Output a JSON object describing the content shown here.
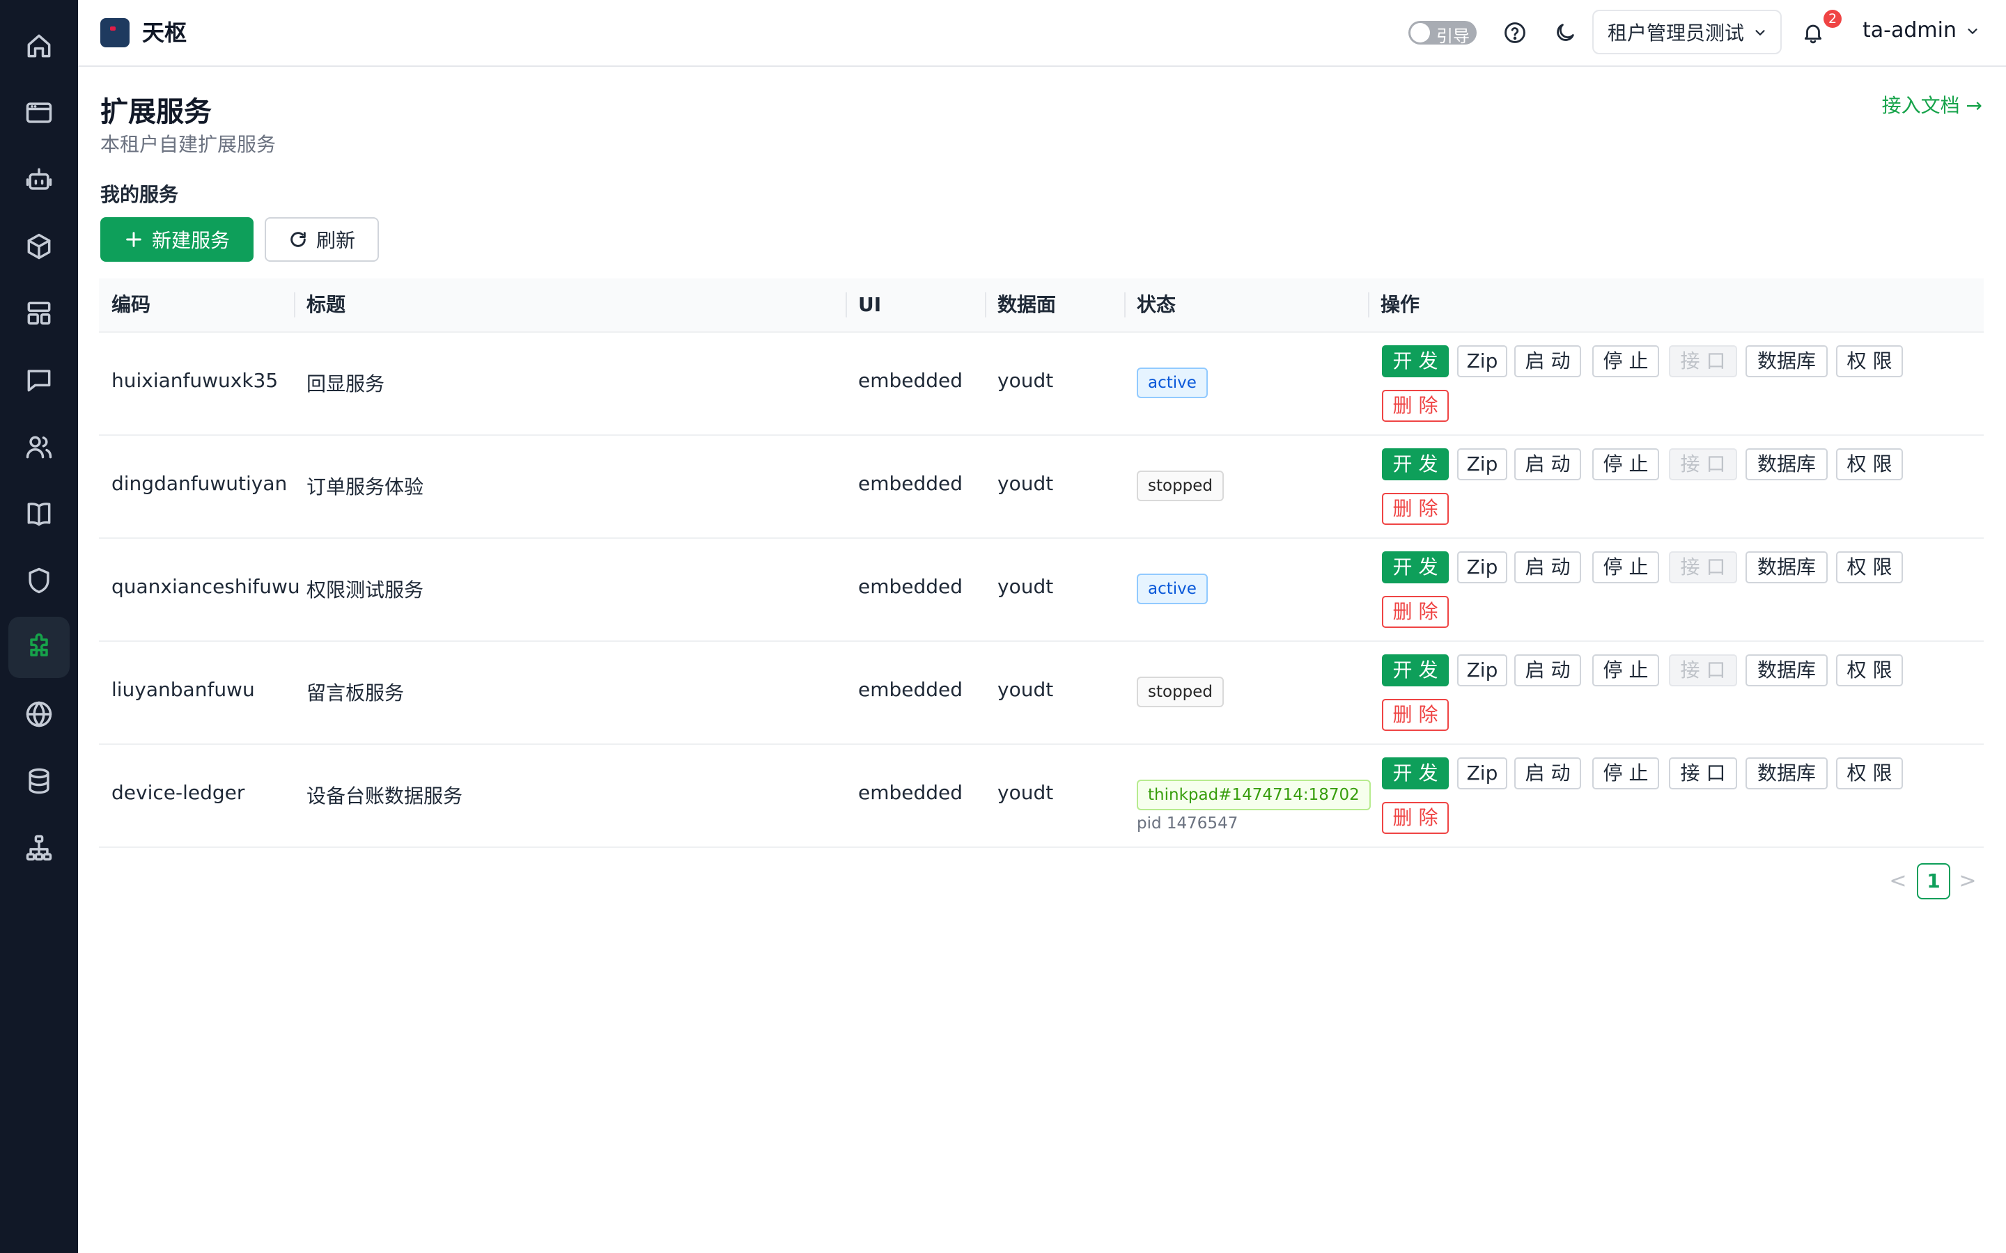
{
  "app": {
    "brand": "天枢"
  },
  "sidebar": {
    "items": [
      {
        "icon": "home-icon",
        "active": false
      },
      {
        "icon": "browser-window-icon",
        "active": false
      },
      {
        "icon": "robot-icon",
        "active": false
      },
      {
        "icon": "box-icon",
        "active": false
      },
      {
        "icon": "layout-icon",
        "active": false
      },
      {
        "icon": "chat-icon",
        "active": false
      },
      {
        "icon": "users-icon",
        "active": false
      },
      {
        "icon": "book-icon",
        "active": false
      },
      {
        "icon": "shield-icon",
        "active": false
      },
      {
        "icon": "puzzle-icon",
        "active": true
      },
      {
        "icon": "globe-icon",
        "active": false
      },
      {
        "icon": "database-icon",
        "active": false
      },
      {
        "icon": "sitemap-icon",
        "active": false
      }
    ]
  },
  "header": {
    "guide_toggle": "引导",
    "tenant": "租户管理员测试",
    "notification_count": "2",
    "user": "ta-admin"
  },
  "page": {
    "title": "扩展服务",
    "subtitle": "本租户自建扩展服务",
    "doc_link": "接入文档 →",
    "section": "我的服务"
  },
  "toolbar": {
    "new_label": "新建服务",
    "refresh_label": "刷新"
  },
  "table": {
    "columns": [
      "编码",
      "标题",
      "UI",
      "数据面",
      "状态",
      "操作"
    ],
    "actions": {
      "dev": "开 发",
      "zip": "Zip",
      "start": "启 动",
      "stop": "停 止",
      "api": "接 口",
      "db": "数据库",
      "perm": "权 限",
      "delete": "删 除"
    },
    "rows": [
      {
        "code": "huixianfuwuxk35",
        "title": "回显服务",
        "ui": "embedded",
        "plane": "youdt",
        "status": "active",
        "status_style": "active",
        "pid": "",
        "api_enabled": false
      },
      {
        "code": "dingdanfuwutiyan",
        "title": "订单服务体验",
        "ui": "embedded",
        "plane": "youdt",
        "status": "stopped",
        "status_style": "stopped",
        "pid": "",
        "api_enabled": false
      },
      {
        "code": "quanxianceshifuwu",
        "title": "权限测试服务",
        "ui": "embedded",
        "plane": "youdt",
        "status": "active",
        "status_style": "active",
        "pid": "",
        "api_enabled": false
      },
      {
        "code": "liuyanbanfuwu",
        "title": "留言板服务",
        "ui": "embedded",
        "plane": "youdt",
        "status": "stopped",
        "status_style": "stopped",
        "pid": "",
        "api_enabled": false
      },
      {
        "code": "device-ledger",
        "title": "设备台账数据服务",
        "ui": "embedded",
        "plane": "youdt",
        "status": "thinkpad#1474714:18702",
        "status_style": "green",
        "pid": "pid 1476547",
        "api_enabled": true
      }
    ]
  },
  "pagination": {
    "current": "1",
    "prev": "<",
    "next": ">"
  },
  "colors": {
    "primary": "#0e9f5a",
    "sidebar": "#111827",
    "danger": "#ef4444",
    "link": "#16a34a"
  }
}
